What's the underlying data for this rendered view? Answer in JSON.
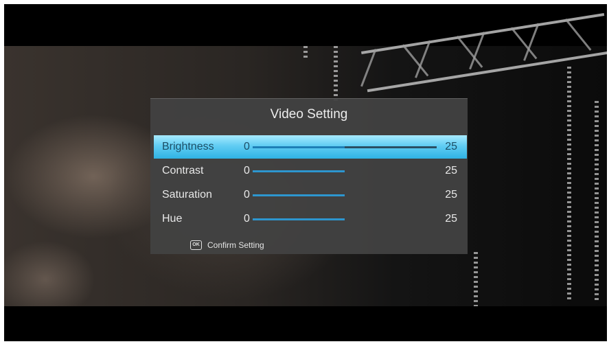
{
  "dialog": {
    "title": "Video Setting",
    "settings": [
      {
        "label": "Brightness",
        "min": "0",
        "max": "25",
        "level": 0.5,
        "selected": true
      },
      {
        "label": "Contrast",
        "min": "0",
        "max": "25",
        "level": 0.5,
        "selected": false
      },
      {
        "label": "Saturation",
        "min": "0",
        "max": "25",
        "level": 0.5,
        "selected": false
      },
      {
        "label": "Hue",
        "min": "0",
        "max": "25",
        "level": 0.5,
        "selected": false
      }
    ],
    "footer": {
      "ok_icon": "OK",
      "text": "Confirm Setting"
    }
  },
  "colors": {
    "highlight": "#5bcbf2",
    "slider_fill": "#2d96cf",
    "dialog_bg": "#424242"
  }
}
